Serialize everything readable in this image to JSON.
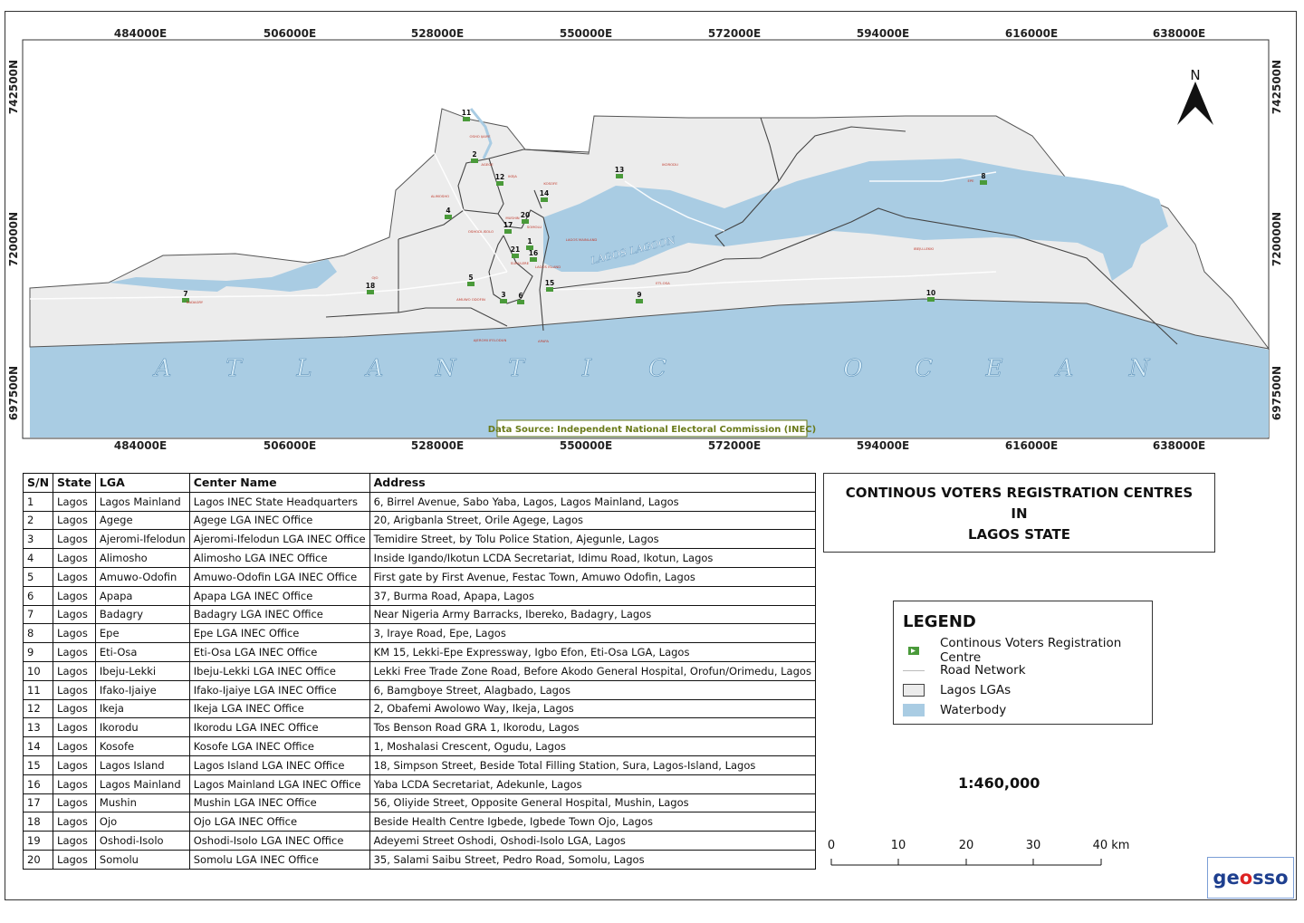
{
  "map": {
    "grid_top_labels": [
      "484000E",
      "506000E",
      "528000E",
      "550000E",
      "572000E",
      "594000E",
      "616000E",
      "638000E"
    ],
    "grid_bottom_labels": [
      "484000E",
      "506000E",
      "528000E",
      "550000E",
      "572000E",
      "594000E",
      "616000E",
      "638000E"
    ],
    "grid_left_labels": [
      "742500N",
      "720000N",
      "697500N"
    ],
    "grid_right_labels": [
      "742500N",
      "720000N",
      "697500N"
    ],
    "north_label": "N",
    "ocean_label": "ATLANTIC OCEAN",
    "lagoon_label": "LAGOS LAGOON",
    "data_source": "Data Source: Independent National Electoral Commission (INEC)",
    "lga_labels": [
      "BADAGRY",
      "OJO",
      "ALIMOSHO",
      "OSHODI-ISOLO",
      "OSHO IJAIYE",
      "AGEGE",
      "IKEJA",
      "KOSOFE",
      "MUSHIN",
      "SOMOLU",
      "SURULERE",
      "AMUWO ODOFIN",
      "AJEROMI IFELODUN",
      "APAPA",
      "LAGOS MAINLAND",
      "LAGOS ISLAND",
      "IKORODU",
      "ETI-OSA",
      "IBEJU-LEKKI",
      "EPE"
    ],
    "centre_markers": [
      "1",
      "2",
      "3",
      "4",
      "5",
      "6",
      "7",
      "8",
      "9",
      "10",
      "11",
      "12",
      "13",
      "14",
      "15",
      "16",
      "17",
      "18",
      "20",
      "21"
    ],
    "colors": {
      "land": "#ececec",
      "water": "#a9cce3",
      "boundary": "#444444",
      "marker": "#4a9a3a",
      "source_text": "#6a7a1a"
    }
  },
  "table": {
    "headers": [
      "S/N",
      "State",
      "LGA",
      "Center Name",
      "Address"
    ],
    "rows": [
      [
        "1",
        "Lagos",
        "Lagos Mainland",
        "Lagos INEC State Headquarters",
        "6, Birrel Avenue, Sabo Yaba, Lagos, Lagos Mainland, Lagos"
      ],
      [
        "2",
        "Lagos",
        "Agege",
        "Agege LGA INEC Office",
        "20, Arigbanla Street, Orile Agege, Lagos"
      ],
      [
        "3",
        "Lagos",
        "Ajeromi-Ifelodun",
        "Ajeromi-Ifelodun LGA INEC Office",
        "Temidire Street, by Tolu Police Station, Ajegunle, Lagos"
      ],
      [
        "4",
        "Lagos",
        "Alimosho",
        "Alimosho LGA INEC Office",
        "Inside Igando/Ikotun LCDA Secretariat, Idimu Road, Ikotun, Lagos"
      ],
      [
        "5",
        "Lagos",
        "Amuwo-Odofin",
        "Amuwo-Odofin LGA INEC Office",
        "First gate by First Avenue, Festac Town, Amuwo Odofin, Lagos"
      ],
      [
        "6",
        "Lagos",
        "Apapa",
        "Apapa LGA INEC Office",
        "37, Burma Road, Apapa, Lagos"
      ],
      [
        "7",
        "Lagos",
        "Badagry",
        "Badagry LGA INEC Office",
        "Near Nigeria Army Barracks, Ibereko, Badagry, Lagos"
      ],
      [
        "8",
        "Lagos",
        "Epe",
        "Epe LGA INEC Office",
        "3, Iraye Road, Epe, Lagos"
      ],
      [
        "9",
        "Lagos",
        "Eti-Osa",
        "Eti-Osa LGA INEC Office",
        "KM 15, Lekki-Epe Expressway, Igbo Efon, Eti-Osa LGA, Lagos"
      ],
      [
        "10",
        "Lagos",
        "Ibeju-Lekki",
        "Ibeju-Lekki LGA INEC Office",
        "Lekki Free Trade Zone Road, Before Akodo General Hospital, Orofun/Orimedu, Lagos"
      ],
      [
        "11",
        "Lagos",
        "Ifako-Ijaiye",
        "Ifako-Ijaiye LGA INEC Office",
        "6, Bamgboye Street, Alagbado, Lagos"
      ],
      [
        "12",
        "Lagos",
        "Ikeja",
        "Ikeja LGA INEC Office",
        "2, Obafemi Awolowo Way, Ikeja, Lagos"
      ],
      [
        "13",
        "Lagos",
        "Ikorodu",
        "Ikorodu LGA INEC Office",
        "Tos Benson Road GRA 1, Ikorodu, Lagos"
      ],
      [
        "14",
        "Lagos",
        "Kosofe",
        "Kosofe LGA INEC Office",
        "1, Moshalasi Crescent, Ogudu, Lagos"
      ],
      [
        "15",
        "Lagos",
        "Lagos Island",
        "Lagos Island LGA INEC Office",
        "18, Simpson Street, Beside Total Filling Station, Sura, Lagos-Island, Lagos"
      ],
      [
        "16",
        "Lagos",
        "Lagos Mainland",
        "Lagos Mainland LGA INEC Office",
        "Yaba LCDA Secretariat, Adekunle, Lagos"
      ],
      [
        "17",
        "Lagos",
        "Mushin",
        "Mushin LGA INEC Office",
        "56, Oliyide Street, Opposite General Hospital, Mushin, Lagos"
      ],
      [
        "18",
        "Lagos",
        "Ojo",
        "Ojo LGA INEC Office",
        "Beside Health Centre Igbede, Igbede Town Ojo, Lagos"
      ],
      [
        "19",
        "Lagos",
        "Oshodi-Isolo",
        "Oshodi-Isolo LGA INEC Office",
        "Adeyemi Street Oshodi, Oshodi-Isolo LGA, Lagos"
      ],
      [
        "20",
        "Lagos",
        "Somolu",
        "Somolu LGA INEC Office",
        "35, Salami Saibu Street, Pedro Road, Somolu, Lagos"
      ]
    ]
  },
  "title": {
    "line1": "CONTINOUS VOTERS REGISTRATION CENTRES",
    "line2": "IN",
    "line3": "LAGOS STATE"
  },
  "legend": {
    "title": "LEGEND",
    "items": [
      {
        "label": "Continous Voters Registration Centre",
        "symbol": "flag-marker"
      },
      {
        "label": "Road Network",
        "symbol": "line"
      },
      {
        "label": "Lagos LGAs",
        "symbol": "land-fill"
      },
      {
        "label": "Waterbody",
        "symbol": "water-fill"
      }
    ]
  },
  "scale": {
    "ratio": "1:460,000",
    "ticks": [
      "0",
      "10",
      "20",
      "30",
      "40 km"
    ]
  },
  "logo": {
    "part1": "ge",
    "part2": "o",
    "part3": "sso"
  }
}
